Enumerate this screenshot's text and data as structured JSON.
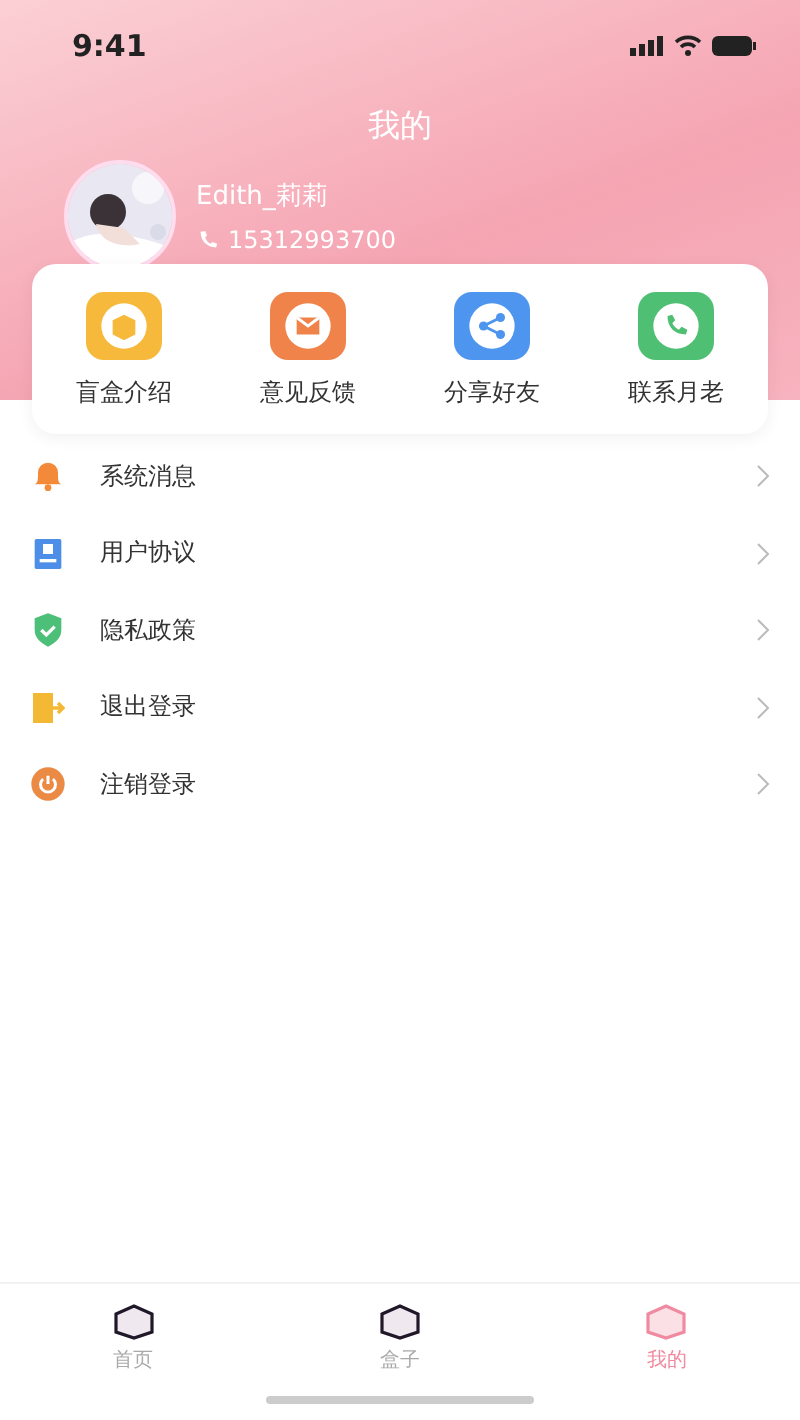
{
  "status_bar": {
    "time": "9:41"
  },
  "header": {
    "title": "我的"
  },
  "profile": {
    "name": "Edith_莉莉",
    "phone": "15312993700"
  },
  "shortcuts": [
    {
      "label": "盲盒介绍",
      "kind": "box",
      "color": "#f6b93b"
    },
    {
      "label": "意见反馈",
      "kind": "mail",
      "color": "#f0834a"
    },
    {
      "label": "分享好友",
      "kind": "share",
      "color": "#4d95ef"
    },
    {
      "label": "联系月老",
      "kind": "phone",
      "color": "#4fbf73"
    }
  ],
  "menu": [
    {
      "label": "系统消息",
      "kind": "bell"
    },
    {
      "label": "用户协议",
      "kind": "doc"
    },
    {
      "label": "隐私政策",
      "kind": "shield"
    },
    {
      "label": "退出登录",
      "kind": "exit"
    },
    {
      "label": "注销登录",
      "kind": "power"
    }
  ],
  "tab_bar": [
    {
      "label": "首页",
      "selected": false
    },
    {
      "label": "盒子",
      "selected": false
    },
    {
      "label": "我的",
      "selected": true
    }
  ]
}
